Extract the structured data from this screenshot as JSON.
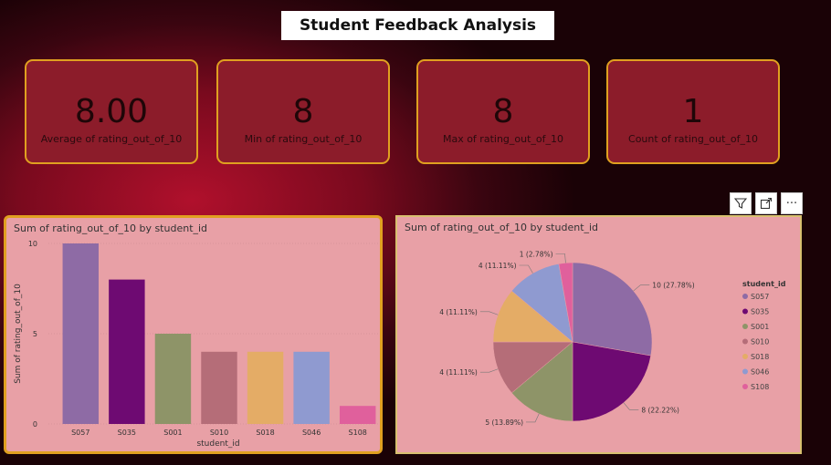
{
  "page_title": "Student Feedback Analysis",
  "cards": [
    {
      "value": "8.00",
      "label": "Average of rating_out_of_10"
    },
    {
      "value": "8",
      "label": "Min of rating_out_of_10"
    },
    {
      "value": "8",
      "label": "Max of rating_out_of_10"
    },
    {
      "value": "1",
      "label": "Count of rating_out_of_10"
    }
  ],
  "toolbar": {
    "filter_icon": "filter-icon",
    "focus_icon": "focus-mode-icon",
    "more_label": "···"
  },
  "chart_data": [
    {
      "type": "bar",
      "title": "Sum of rating_out_of_10 by student_id",
      "xlabel": "student_id",
      "ylabel": "Sum of rating_out_of_10",
      "categories": [
        "S057",
        "S035",
        "S001",
        "S010",
        "S018",
        "S046",
        "S108"
      ],
      "values": [
        10,
        8,
        5,
        4,
        4,
        4,
        1
      ],
      "colors": [
        "#8e6ba5",
        "#6e0a72",
        "#8e9468",
        "#b56d78",
        "#e4ac66",
        "#8f9ad0",
        "#e0609c"
      ],
      "ylim": [
        0,
        10
      ],
      "yticks": [
        "0",
        "5",
        "10"
      ],
      "grid": true
    },
    {
      "type": "pie",
      "title": "Sum of rating_out_of_10 by student_id",
      "legend_title": "student_id",
      "legend_position": "right",
      "categories": [
        "S057",
        "S035",
        "S001",
        "S010",
        "S018",
        "S046",
        "S108"
      ],
      "values": [
        10,
        8,
        5,
        4,
        4,
        4,
        1
      ],
      "labels": [
        "10 (27.78%)",
        "8 (22.22%)",
        "5 (13.89%)",
        "4 (11.11%)",
        "4 (11.11%)",
        "4 (11.11%)",
        "1 (2.78%)"
      ],
      "colors": [
        "#8e6ba5",
        "#6e0a72",
        "#8e9468",
        "#b56d78",
        "#e4ac66",
        "#8f9ad0",
        "#e0609c"
      ]
    }
  ]
}
